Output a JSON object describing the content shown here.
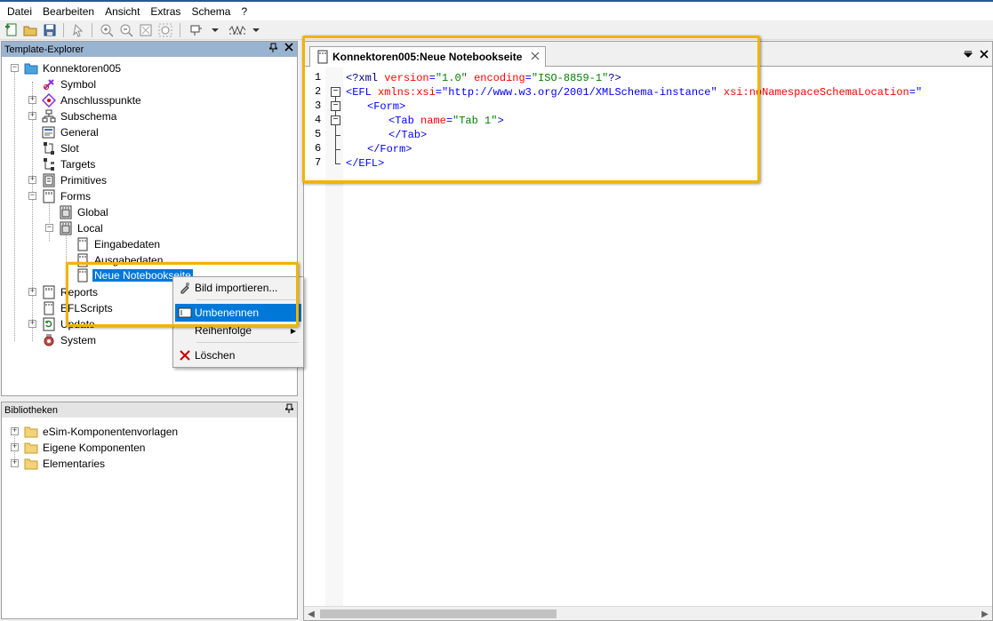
{
  "menubar": {
    "items": [
      "Datei",
      "Bearbeiten",
      "Ansicht",
      "Extras",
      "Schema",
      "?"
    ]
  },
  "explorer": {
    "title": "Template-Explorer",
    "pin_icon": "pin-icon",
    "close_icon": "close-icon",
    "root": "Konnektoren005",
    "items": {
      "symbol": "Symbol",
      "anschlusspunkte": "Anschlusspunkte",
      "subschema": "Subschema",
      "general": "General",
      "slot": "Slot",
      "targets": "Targets",
      "primitives": "Primitives",
      "forms": "Forms",
      "global": "Global",
      "local": "Local",
      "eingabedaten": "Eingabedaten",
      "ausgabedaten": "Ausgabedaten",
      "neue_notebookseite": "Neue Notebookseite",
      "reports": "Reports",
      "eflscripts": "EFLScripts",
      "update": "Update",
      "system": "System"
    }
  },
  "context_menu": {
    "bild_importieren": "Bild importieren...",
    "umbenennen": "Umbenennen",
    "reihenfolge": "Reihenfolge",
    "loeschen": "Löschen"
  },
  "libraries": {
    "title": "Bibliotheken",
    "items": [
      "eSim-Komponentenvorlagen",
      "Eigene Komponenten",
      "Elementaries"
    ]
  },
  "editor": {
    "tab_title": "Konnektoren005:Neue Notebookseite",
    "line_numbers": [
      "1",
      "2",
      "3",
      "4",
      "5",
      "6",
      "7"
    ],
    "code": {
      "l1_open": "<?xml ",
      "l1_a1": "version",
      "l1_eq1": "=",
      "l1_v1": "\"1.0\"",
      "l1_a2": "encoding",
      "l1_eq2": "=",
      "l1_v2": "\"ISO-8859-1\"",
      "l1_close": "?>",
      "l2_open": "<EFL ",
      "l2_a1": "xmlns:xsi",
      "l2_eq1": "=",
      "l2_v1": "\"http://www.w3.org/2001/XMLSchema-instance\"",
      "l2_a2": " xsi:noNamespaceSchemaLocation",
      "l2_eq2": "=",
      "l2_v2": "\"",
      "l3": "<Form>",
      "l4_open": "<Tab ",
      "l4_a1": "name",
      "l4_eq1": "=",
      "l4_v1": "\"Tab 1\"",
      "l4_close": ">",
      "l5": "</Tab>",
      "l6": "</Form>",
      "l7": "</EFL>"
    }
  },
  "colors": {
    "explorer_header": "#99b4d1",
    "selection": "#0078d7",
    "highlight_frame": "#f0b400",
    "xml_tag": "#0000ff",
    "xml_attr": "#ff0000",
    "xml_value": "#008000"
  }
}
